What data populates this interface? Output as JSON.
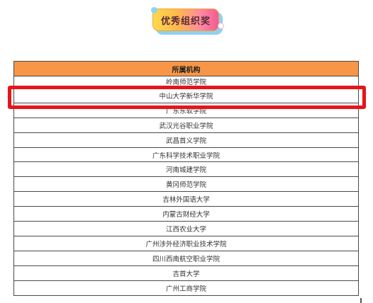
{
  "badge": {
    "label": "优秀组织奖"
  },
  "table": {
    "header": "所属机构",
    "rows": [
      "岭南师范学院",
      "中山大学新华学院",
      "广东东软学院",
      "武汉光谷职业学院",
      "武昌首义学院",
      "广东科学技术职业学院",
      "河南城建学院",
      "黄冈师范学院",
      "吉林外国语大学",
      "内蒙古财经大学",
      "江西农业大学",
      "广州涉外经济职业技术学院",
      "四川西南航空职业学院",
      "吉首大学",
      "广州工商学院"
    ]
  },
  "colors": {
    "header_bg": "#f79646",
    "highlight": "#e8141b"
  }
}
